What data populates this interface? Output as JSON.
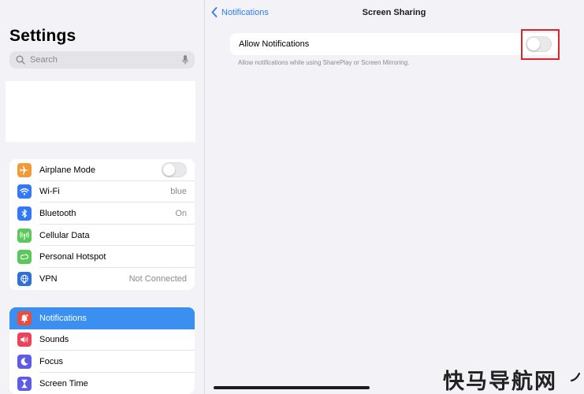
{
  "sidebar": {
    "title": "Settings",
    "search": {
      "placeholder": "Search"
    },
    "group1": [
      {
        "label": "Airplane Mode",
        "icon": "airplane-icon",
        "color": "#f19a37",
        "value": "",
        "toggle": false
      },
      {
        "label": "Wi-Fi",
        "icon": "wifi-icon",
        "color": "#3478f6",
        "value": "blue"
      },
      {
        "label": "Bluetooth",
        "icon": "bluetooth-icon",
        "color": "#3478f6",
        "value": "On"
      },
      {
        "label": "Cellular Data",
        "icon": "cellular-icon",
        "color": "#5ac85a",
        "value": ""
      },
      {
        "label": "Personal Hotspot",
        "icon": "hotspot-icon",
        "color": "#5ac85a",
        "value": ""
      },
      {
        "label": "VPN",
        "icon": "vpn-icon",
        "color": "#2f6fd6",
        "value": "Not Connected"
      }
    ],
    "group2": [
      {
        "label": "Notifications",
        "icon": "bell-icon",
        "color": "#eb4d3d",
        "selected": true
      },
      {
        "label": "Sounds",
        "icon": "speaker-icon",
        "color": "#eb445a"
      },
      {
        "label": "Focus",
        "icon": "moon-icon",
        "color": "#5e5ce6"
      },
      {
        "label": "Screen Time",
        "icon": "hourglass-icon",
        "color": "#5e5ce6"
      }
    ]
  },
  "detail": {
    "back_label": "Notifications",
    "title": "Screen Sharing",
    "setting_label": "Allow Notifications",
    "setting_on": false,
    "footnote": "Allow notifications while using SharePlay or Screen Mirroring."
  },
  "watermark": "快马导航网",
  "colors": {
    "accent": "#2f7cf6",
    "selected_bg": "#3a8ff0",
    "highlight": "#d8262c"
  }
}
